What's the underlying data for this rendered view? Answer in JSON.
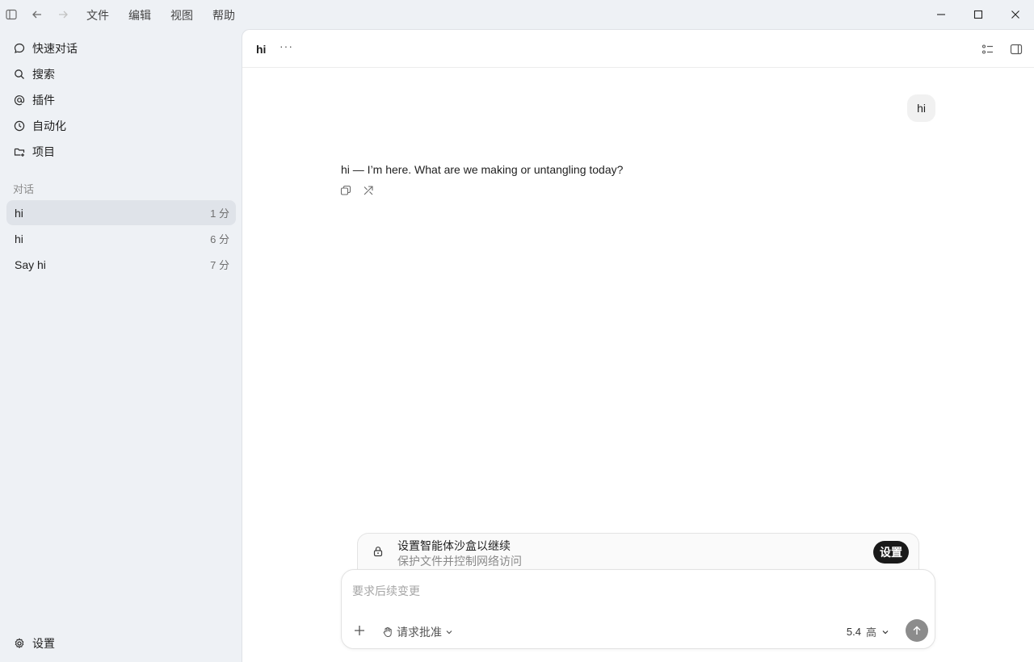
{
  "titlebar": {
    "menus": [
      "文件",
      "编辑",
      "视图",
      "帮助"
    ],
    "icons": [
      "sidebar-toggle-icon",
      "back-arrow-icon",
      "forward-arrow-icon",
      "minimize-icon",
      "maximize-icon",
      "close-icon"
    ]
  },
  "sidebar": {
    "nav": [
      {
        "label": "快速对话",
        "icon": "chat-bubble-icon"
      },
      {
        "label": "搜索",
        "icon": "search-icon"
      },
      {
        "label": "插件",
        "icon": "at-sign-icon"
      },
      {
        "label": "自动化",
        "icon": "clock-icon"
      },
      {
        "label": "项目",
        "icon": "folder-plus-icon"
      }
    ],
    "section_label": "对话",
    "conversations": [
      {
        "title": "hi",
        "time": "1 分",
        "active": true
      },
      {
        "title": "hi",
        "time": "6 分",
        "active": false
      },
      {
        "title": "Say hi",
        "time": "7 分",
        "active": false
      }
    ],
    "settings_label": "设置"
  },
  "header": {
    "title": "hi",
    "more": "···"
  },
  "messages": {
    "user": "hi",
    "assistant": "hi — I’m here. What are we making or untangling today?"
  },
  "sandbox": {
    "title": "设置智能体沙盒以继续",
    "subtitle": "保护文件并控制网络访问",
    "button": "设置"
  },
  "composer": {
    "placeholder": "要求后续变更",
    "approval_label": "请求批准",
    "model_version": "5.4",
    "model_level": "高"
  },
  "colors": {
    "sidebar_bg": "#eef1f5",
    "active_row": "#dfe3e9",
    "setup_button": "#1a1a1a",
    "send_button": "#8c8c8c"
  }
}
